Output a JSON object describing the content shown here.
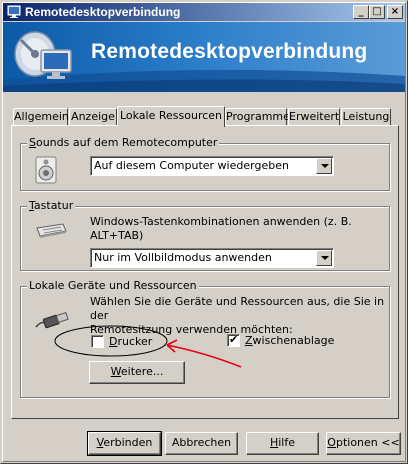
{
  "window": {
    "title": "Remotedesktopverbindung",
    "minimize_glyph": "_",
    "maximize_glyph": "□",
    "close_glyph": "×"
  },
  "banner": {
    "title": "Remotedesktopverbindung"
  },
  "tabs": [
    {
      "label": "Allgemein",
      "active": false
    },
    {
      "label": "Anzeige",
      "active": false
    },
    {
      "label": "Lokale Ressourcen",
      "active": true
    },
    {
      "label": "Programme",
      "active": false
    },
    {
      "label": "Erweitert",
      "active": false
    },
    {
      "label": "Leistung",
      "active": false
    }
  ],
  "sounds": {
    "group_label_accel": "S",
    "group_label_rest": "ounds auf dem Remotecomputer",
    "selected": "Auf diesem Computer wiedergeben",
    "icon": "speaker-icon"
  },
  "keyboard": {
    "group_label_accel": "T",
    "group_label_rest": "astatur",
    "description_line1": "Windows-Tastenkombinationen anwenden (z. B.",
    "description_line2": "ALT+TAB)",
    "selected": "Nur im Vollbildmodus anwenden",
    "icon": "keyboard-icon"
  },
  "local_devices": {
    "group_label": "Lokale Geräte und Ressourcen",
    "description_line1": "Wählen Sie die Geräte und Ressourcen aus, die Sie in der",
    "description_line2": "Remotesitzung verwenden möchten:",
    "printers_accel": "D",
    "printers_rest": "rucker",
    "printers_checked": false,
    "clipboard_accel": "Z",
    "clipboard_rest": "wischenablage",
    "clipboard_checked": true,
    "check_glyph": "✔",
    "more_accel": "W",
    "more_rest": "eitere...",
    "icon": "usb-plug-icon"
  },
  "buttons": {
    "connect_accel": "V",
    "connect_rest": "erbinden",
    "cancel": "Abbrechen",
    "help_accel": "H",
    "help_rest": "ilfe",
    "options_accel": "O",
    "options_rest": "ptionen <<"
  },
  "colors": {
    "title_start": "#0a246a",
    "title_end": "#a6caf0",
    "face": "#d4d0c8",
    "annotation": "#e8000f"
  }
}
